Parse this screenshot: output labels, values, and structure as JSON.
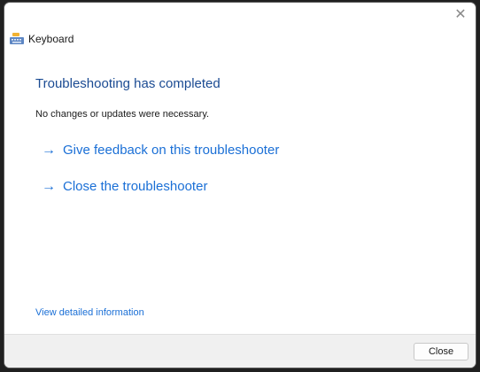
{
  "window": {
    "title": "Keyboard",
    "close_glyph": "✕"
  },
  "content": {
    "heading": "Troubleshooting has completed",
    "message": "No changes or updates were necessary.",
    "actions": [
      {
        "icon": "arrow-right-icon",
        "arrow": "→",
        "label": "Give feedback on this troubleshooter"
      },
      {
        "icon": "arrow-right-icon",
        "arrow": "→",
        "label": "Close the troubleshooter"
      }
    ],
    "details_link": "View detailed information"
  },
  "footer": {
    "close_label": "Close"
  },
  "colors": {
    "heading": "#1b4b93",
    "link": "#1a6fd6",
    "footer_bg": "#f0f0f0"
  }
}
